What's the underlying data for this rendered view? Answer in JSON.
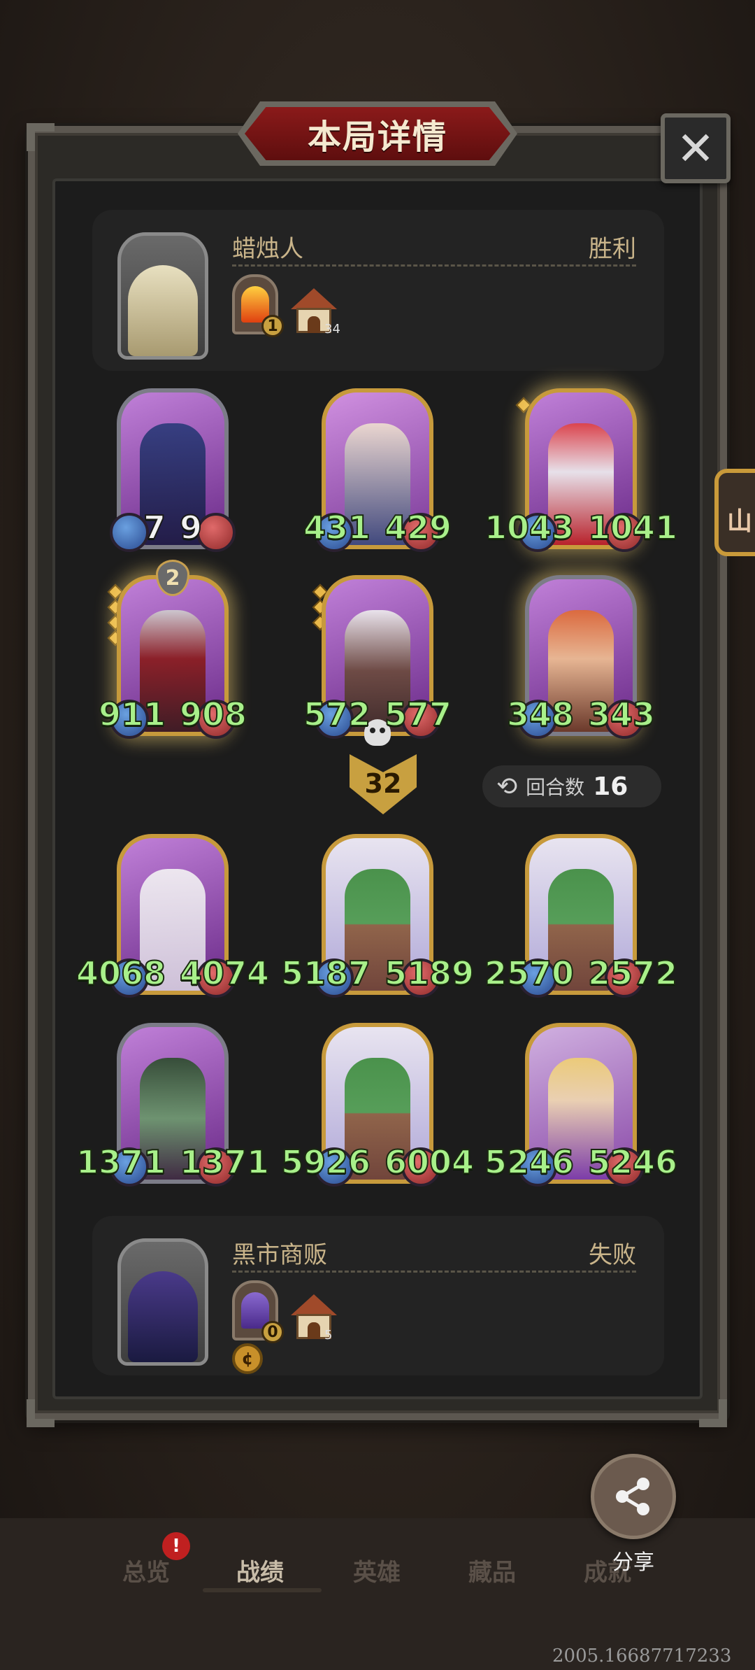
{
  "title": "本局详情",
  "close_label": "✕",
  "edge_tab": "山",
  "top_player": {
    "name": "蜡烛人",
    "result": "胜利",
    "relic_level": "1",
    "house_count": "34"
  },
  "bottom_player": {
    "name": "黑市商贩",
    "result": "失败",
    "relic_level": "0",
    "house_count": "5"
  },
  "top_board": [
    {
      "atk": "7",
      "hp": "9",
      "white": true
    },
    {
      "atk": "431",
      "hp": "429"
    },
    {
      "atk": "1043",
      "hp": "1041"
    },
    {
      "atk": "911",
      "hp": "908",
      "tier": "2"
    },
    {
      "atk": "572",
      "hp": "577"
    },
    {
      "atk": "348",
      "hp": "343"
    }
  ],
  "bottom_board": [
    {
      "atk": "4068",
      "hp": "4074"
    },
    {
      "atk": "5187",
      "hp": "5189"
    },
    {
      "atk": "2570",
      "hp": "2572"
    },
    {
      "atk": "1371",
      "hp": "1371"
    },
    {
      "atk": "5926",
      "hp": "6004"
    },
    {
      "atk": "5246",
      "hp": "5246"
    }
  ],
  "damage": "32",
  "rounds": {
    "label": "回合数",
    "value": "16"
  },
  "share_label": "分享",
  "nav": {
    "overview": "总览",
    "record": "战绩",
    "heroes": "英雄",
    "collection": "藏品",
    "achievements": "成就",
    "badge": "!"
  },
  "version": "2005.16687717233"
}
